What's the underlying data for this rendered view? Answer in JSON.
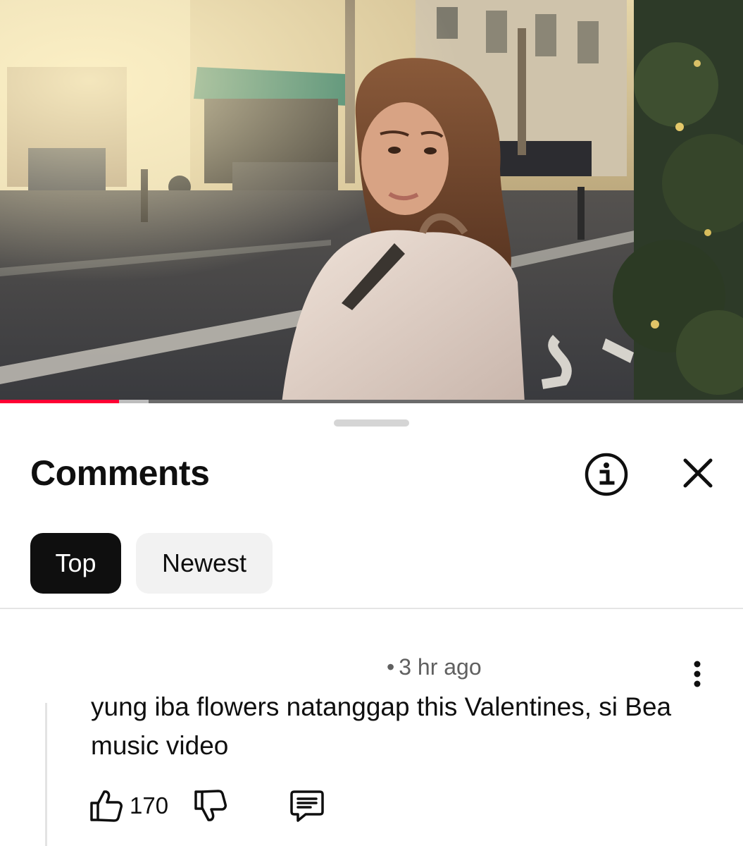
{
  "player": {
    "progress_played": 0.16,
    "progress_buffered": 0.2,
    "progress_color": "#ff0033"
  },
  "comments_panel": {
    "title": "Comments",
    "info_icon": "info-icon",
    "close_icon": "close-icon",
    "sort_chips": [
      {
        "label": "Top",
        "selected": true
      },
      {
        "label": "Newest",
        "selected": false
      }
    ]
  },
  "comment": {
    "time": "3 hr ago",
    "separator": "•",
    "text": "yung iba flowers natanggap this Valentines, si Bea music video",
    "like_count": "170",
    "icons": [
      "like-icon",
      "dislike-icon",
      "reply-icon",
      "more-vert-icon"
    ]
  }
}
